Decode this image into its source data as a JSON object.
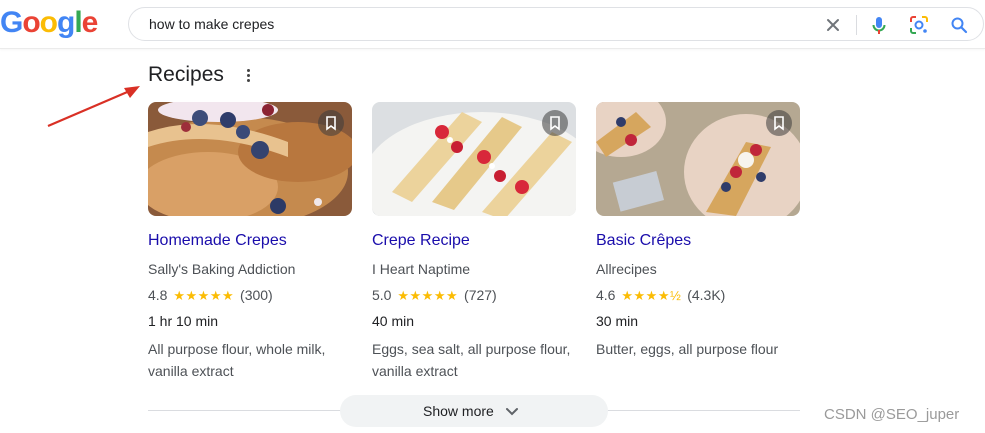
{
  "header": {
    "logo_letters": [
      {
        "char": "G",
        "color": "#4285F4"
      },
      {
        "char": "o",
        "color": "#EA4335"
      },
      {
        "char": "o",
        "color": "#FBBC05"
      },
      {
        "char": "g",
        "color": "#4285F4"
      },
      {
        "char": "l",
        "color": "#34A853"
      },
      {
        "char": "e",
        "color": "#EA4335"
      }
    ],
    "search_query": "how to make crepes",
    "icons": [
      "close-icon",
      "microphone-icon",
      "lens-icon",
      "search-icon"
    ]
  },
  "section": {
    "title": "Recipes"
  },
  "cards": [
    {
      "title": "Homemade Crepes",
      "source": "Sally's Baking Addiction",
      "rating": "4.8",
      "stars": "★★★★★",
      "stars_value": 4.8,
      "reviews": "(300)",
      "time": "1 hr 10 min",
      "ingredients": "All purpose flour, whole milk, vanilla extract"
    },
    {
      "title": "Crepe Recipe",
      "source": "I Heart Naptime",
      "rating": "5.0",
      "stars": "★★★★★",
      "stars_value": 5.0,
      "reviews": "(727)",
      "time": "40 min",
      "ingredients": "Eggs, sea salt, all purpose flour, vanilla extract"
    },
    {
      "title": "Basic Crêpes",
      "source": "Allrecipes",
      "rating": "4.6",
      "stars": "★★★★½",
      "stars_value": 4.6,
      "reviews": "(4.3K)",
      "time": "30 min",
      "ingredients": "Butter, eggs, all purpose flour"
    }
  ],
  "show_more": {
    "label": "Show more"
  },
  "watermark": "CSDN @SEO_juper",
  "colors": {
    "link": "#1a0dab",
    "star": "#fbbc04",
    "arrow": "#d93025"
  }
}
